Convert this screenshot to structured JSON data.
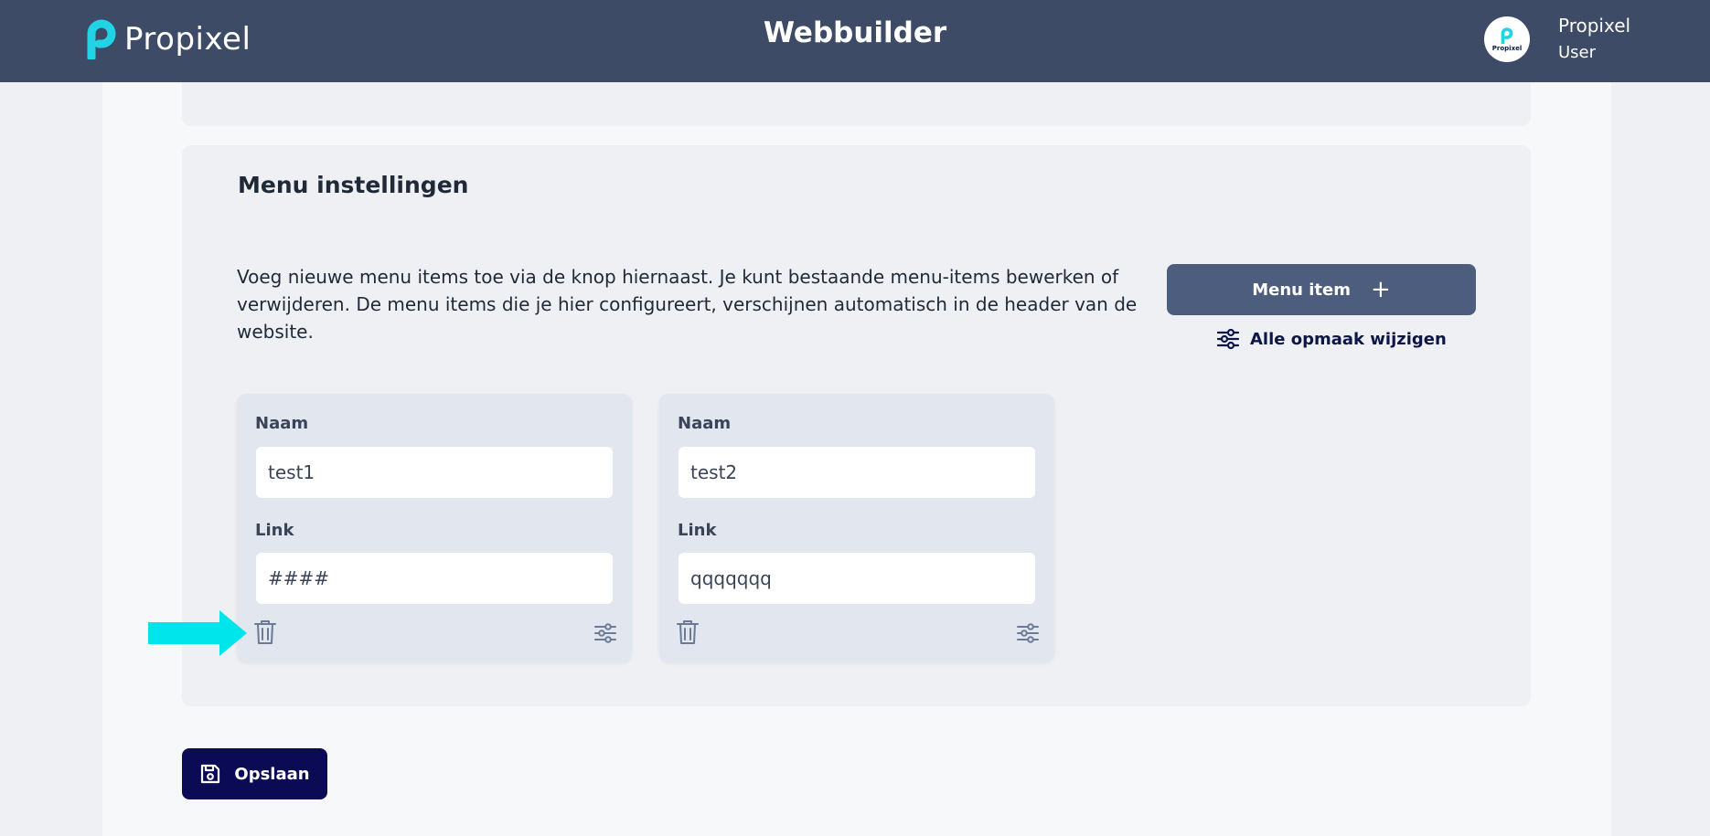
{
  "header": {
    "brand": "Propixel",
    "title": "Webbuilder",
    "avatar_text": "Propixel",
    "user_name": "Propixel",
    "user_role": "User"
  },
  "menu_settings": {
    "title": "Menu instellingen",
    "description": "Voeg nieuwe menu items toe via de knop hiernaast. Je kunt bestaande menu-items bewerken of verwijderen. De menu items die je hier configureert, verschijnen automatisch in de header van de website.",
    "add_button": "Menu item",
    "style_link": "Alle opmaak wijzigen",
    "items": [
      {
        "name_label": "Naam",
        "name_value": "test1",
        "link_label": "Link",
        "link_value": "####"
      },
      {
        "name_label": "Naam",
        "name_value": "test2",
        "link_label": "Link",
        "link_value": "qqqqqqq"
      }
    ]
  },
  "footer": {
    "save_button": "Opslaan"
  },
  "icons": [
    "propixel-logo-icon",
    "plus-icon",
    "sliders-icon",
    "trash-icon",
    "save-icon",
    "arrow-right-icon"
  ],
  "colors": {
    "header_bg": "#3d4b66",
    "brand_cyan": "#22d3e6",
    "add_button_bg": "#4c5d7d",
    "save_button_bg": "#0b0b55",
    "annotation_arrow": "#00e5ec"
  }
}
